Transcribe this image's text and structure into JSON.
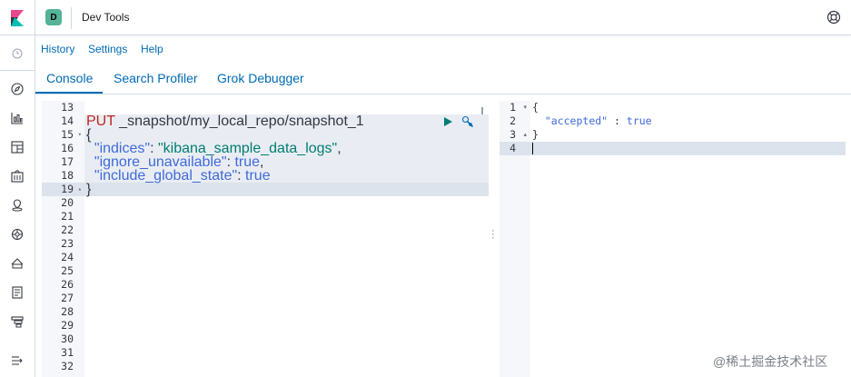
{
  "header": {
    "space_initial": "D",
    "title": "Dev Tools"
  },
  "topmenu": {
    "history": "History",
    "settings": "Settings",
    "help": "Help"
  },
  "tabs": [
    "Console",
    "Search Profiler",
    "Grok Debugger"
  ],
  "request_editor": {
    "line_numbers": [
      "13",
      "14",
      "15",
      "16",
      "17",
      "18",
      "19",
      "20",
      "21",
      "22",
      "23",
      "24",
      "25",
      "26",
      "27",
      "28",
      "29",
      "30",
      "31",
      "32"
    ],
    "method": "PUT",
    "path": "_snapshot/my_local_repo/snapshot_1",
    "open_brace": "{",
    "indices_key": "\"indices\"",
    "indices_value": "\"kibana_sample_data_logs\"",
    "ignore_key": "\"ignore_unavailable\"",
    "ignore_value": "true",
    "include_key": "\"include_global_state\"",
    "include_value": "true",
    "close_brace": "}"
  },
  "response_editor": {
    "line_numbers": [
      "1",
      "2",
      "3",
      "4"
    ],
    "open_brace": "{",
    "accepted_key": "\"accepted\"",
    "accepted_value": "true",
    "close_brace": "}"
  },
  "watermark": "@稀土掘金技术社区",
  "colors": {
    "accent": "#006bb4",
    "method": "#bd271e",
    "string": "#017d73",
    "keyword": "#3f6ad8",
    "run": "#017d73"
  }
}
